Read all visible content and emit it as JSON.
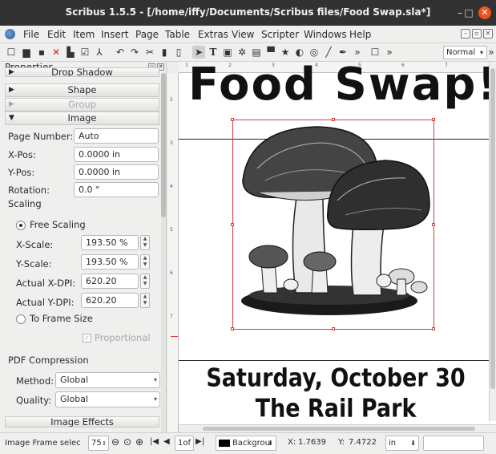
{
  "window": {
    "title": "Scribus 1.5.5 - [/home/iffy/Documents/Scribus files/Food Swap.sla*]"
  },
  "menubar": {
    "items": [
      "File",
      "Edit",
      "Item",
      "Insert",
      "Page",
      "Table",
      "Extras",
      "View",
      "Scripter",
      "Windows",
      "Help"
    ]
  },
  "toolbar": {
    "mode_select": "Normal"
  },
  "properties": {
    "title": "Properties",
    "sections": {
      "drop_shadow": "Drop Shadow",
      "shape": "Shape",
      "group": "Group",
      "image": "Image",
      "image_effects": "Image Effects"
    },
    "page_number_label": "Page Number:",
    "page_number_value": "Auto",
    "xpos_label": "X-Pos:",
    "xpos_value": "0.0000 in",
    "ypos_label": "Y-Pos:",
    "ypos_value": "0.0000 in",
    "rotation_label": "Rotation:",
    "rotation_value": "0.0 °",
    "scaling_label": "Scaling",
    "free_scaling_label": "Free Scaling",
    "xscale_label": "X-Scale:",
    "xscale_value": "193.50 %",
    "yscale_label": "Y-Scale:",
    "yscale_value": "193.50 %",
    "actual_xdpi_label": "Actual X-DPI:",
    "actual_xdpi_value": "620.20",
    "actual_ydpi_label": "Actual Y-DPI:",
    "actual_ydpi_value": "620.20",
    "to_frame_size_label": "To Frame Size",
    "proportional_label": "Proportional",
    "pdf_compression_label": "PDF Compression",
    "method_label": "Method:",
    "method_value": "Global",
    "quality_label": "Quality:",
    "quality_value": "Global"
  },
  "canvas": {
    "ruler_marks": [
      "1",
      "2",
      "3",
      "4",
      "5",
      "6",
      "7"
    ],
    "headline_top": "Food Swap!",
    "event_date": "Saturday, October 30",
    "event_place": "The Rail Park"
  },
  "statusbar": {
    "message": "Image Frame selec",
    "zoom": "75",
    "page": "1of",
    "layer": "Backgrou",
    "x_label": "X:",
    "x_value": "1.7639",
    "y_label": "Y:",
    "y_value": "7.4722",
    "unit": "in"
  },
  "colors": {
    "titlebar": "#323232",
    "close_button": "#e95420",
    "frame_selection": "#d83a3a"
  }
}
